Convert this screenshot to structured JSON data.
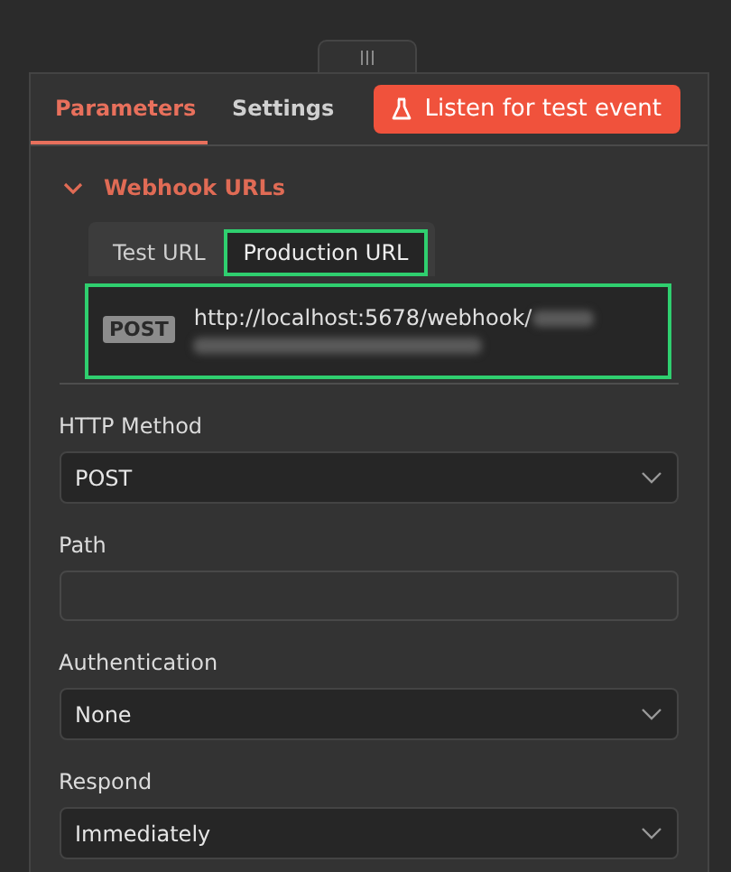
{
  "tabs": [
    {
      "label": "Parameters",
      "selected": true
    },
    {
      "label": "Settings",
      "selected": false
    }
  ],
  "listen_button": {
    "label": "Listen for test event"
  },
  "webhook_section": {
    "title": "Webhook URLs",
    "expanded": true,
    "url_tabs": [
      {
        "label": "Test URL",
        "selected": false,
        "highlighted": false
      },
      {
        "label": "Production URL",
        "selected": true,
        "highlighted": true
      }
    ],
    "url_box": {
      "method": "POST",
      "url": "http://localhost:5678/webhook/",
      "highlighted": true
    }
  },
  "fields": [
    {
      "kind": "select",
      "label": "HTTP Method",
      "value": "POST"
    },
    {
      "kind": "text",
      "label": "Path"
    },
    {
      "kind": "select",
      "label": "Authentication",
      "value": "None"
    },
    {
      "kind": "select",
      "label": "Respond",
      "value": "Immediately"
    }
  ]
}
